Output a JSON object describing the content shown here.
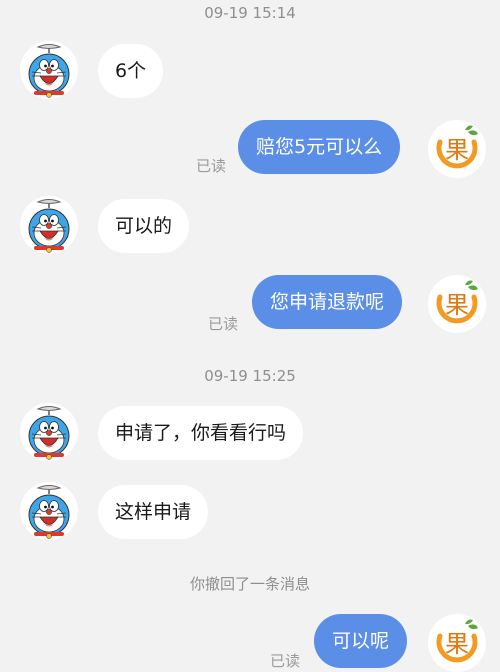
{
  "colors": {
    "outgoing_bubble": "#5b8ee6",
    "incoming_bubble": "#ffffff",
    "background": "#f2f2f2"
  },
  "timestamps": [
    "09-19 15:14",
    "09-19 15:25"
  ],
  "messages": [
    {
      "from": "other",
      "text": "6个",
      "avatar": "doraemon-avatar"
    },
    {
      "from": "me",
      "text": "赔您5元可以么",
      "status": "已读",
      "avatar": "guo-logo-avatar"
    },
    {
      "from": "other",
      "text": "可以的",
      "avatar": "doraemon-avatar"
    },
    {
      "from": "me",
      "text": "您申请退款呢",
      "status": "已读",
      "avatar": "guo-logo-avatar"
    },
    {
      "from": "other",
      "text": "申请了，你看看行吗",
      "avatar": "doraemon-avatar"
    },
    {
      "from": "other",
      "text": "这样申请",
      "avatar": "doraemon-avatar"
    },
    {
      "from": "me",
      "text": "可以呢",
      "status": "已读",
      "avatar": "guo-logo-avatar"
    }
  ],
  "system_notice": "你撤回了一条消息",
  "logo_char": "果"
}
